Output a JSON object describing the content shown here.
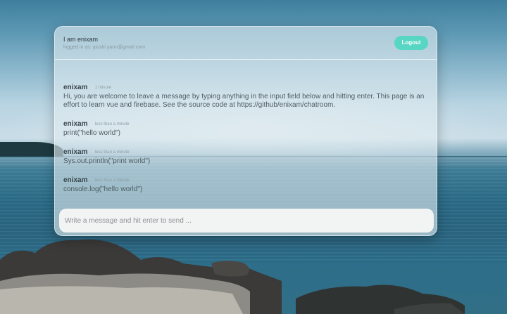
{
  "header": {
    "user_name": "I am enixam",
    "logged_in_as": "logged in as: qiushi.yann@gmail.com",
    "logout_label": "Logout"
  },
  "messages": [
    {
      "author": "enixam",
      "time": "1 minute",
      "text": "Hi, you are welcome to leave a message by typing anything in the input field below and hitting enter. This page is an effort to learn vue and firebase. See the source code at https://github/enixam/chatroom."
    },
    {
      "author": "enixam",
      "time": "less than a minute",
      "text": "print(\"hello world\")"
    },
    {
      "author": "enixam",
      "time": "less than a minute",
      "text": "Sys.out.println(\"print world\")"
    },
    {
      "author": "enixam",
      "time": "less than a minute",
      "text": "console.log(\"hello world\")"
    }
  ],
  "composer": {
    "placeholder": "Write a message and hit enter to send ..."
  },
  "colors": {
    "accent": "#56d6c3",
    "card": "#e1ecf1"
  }
}
